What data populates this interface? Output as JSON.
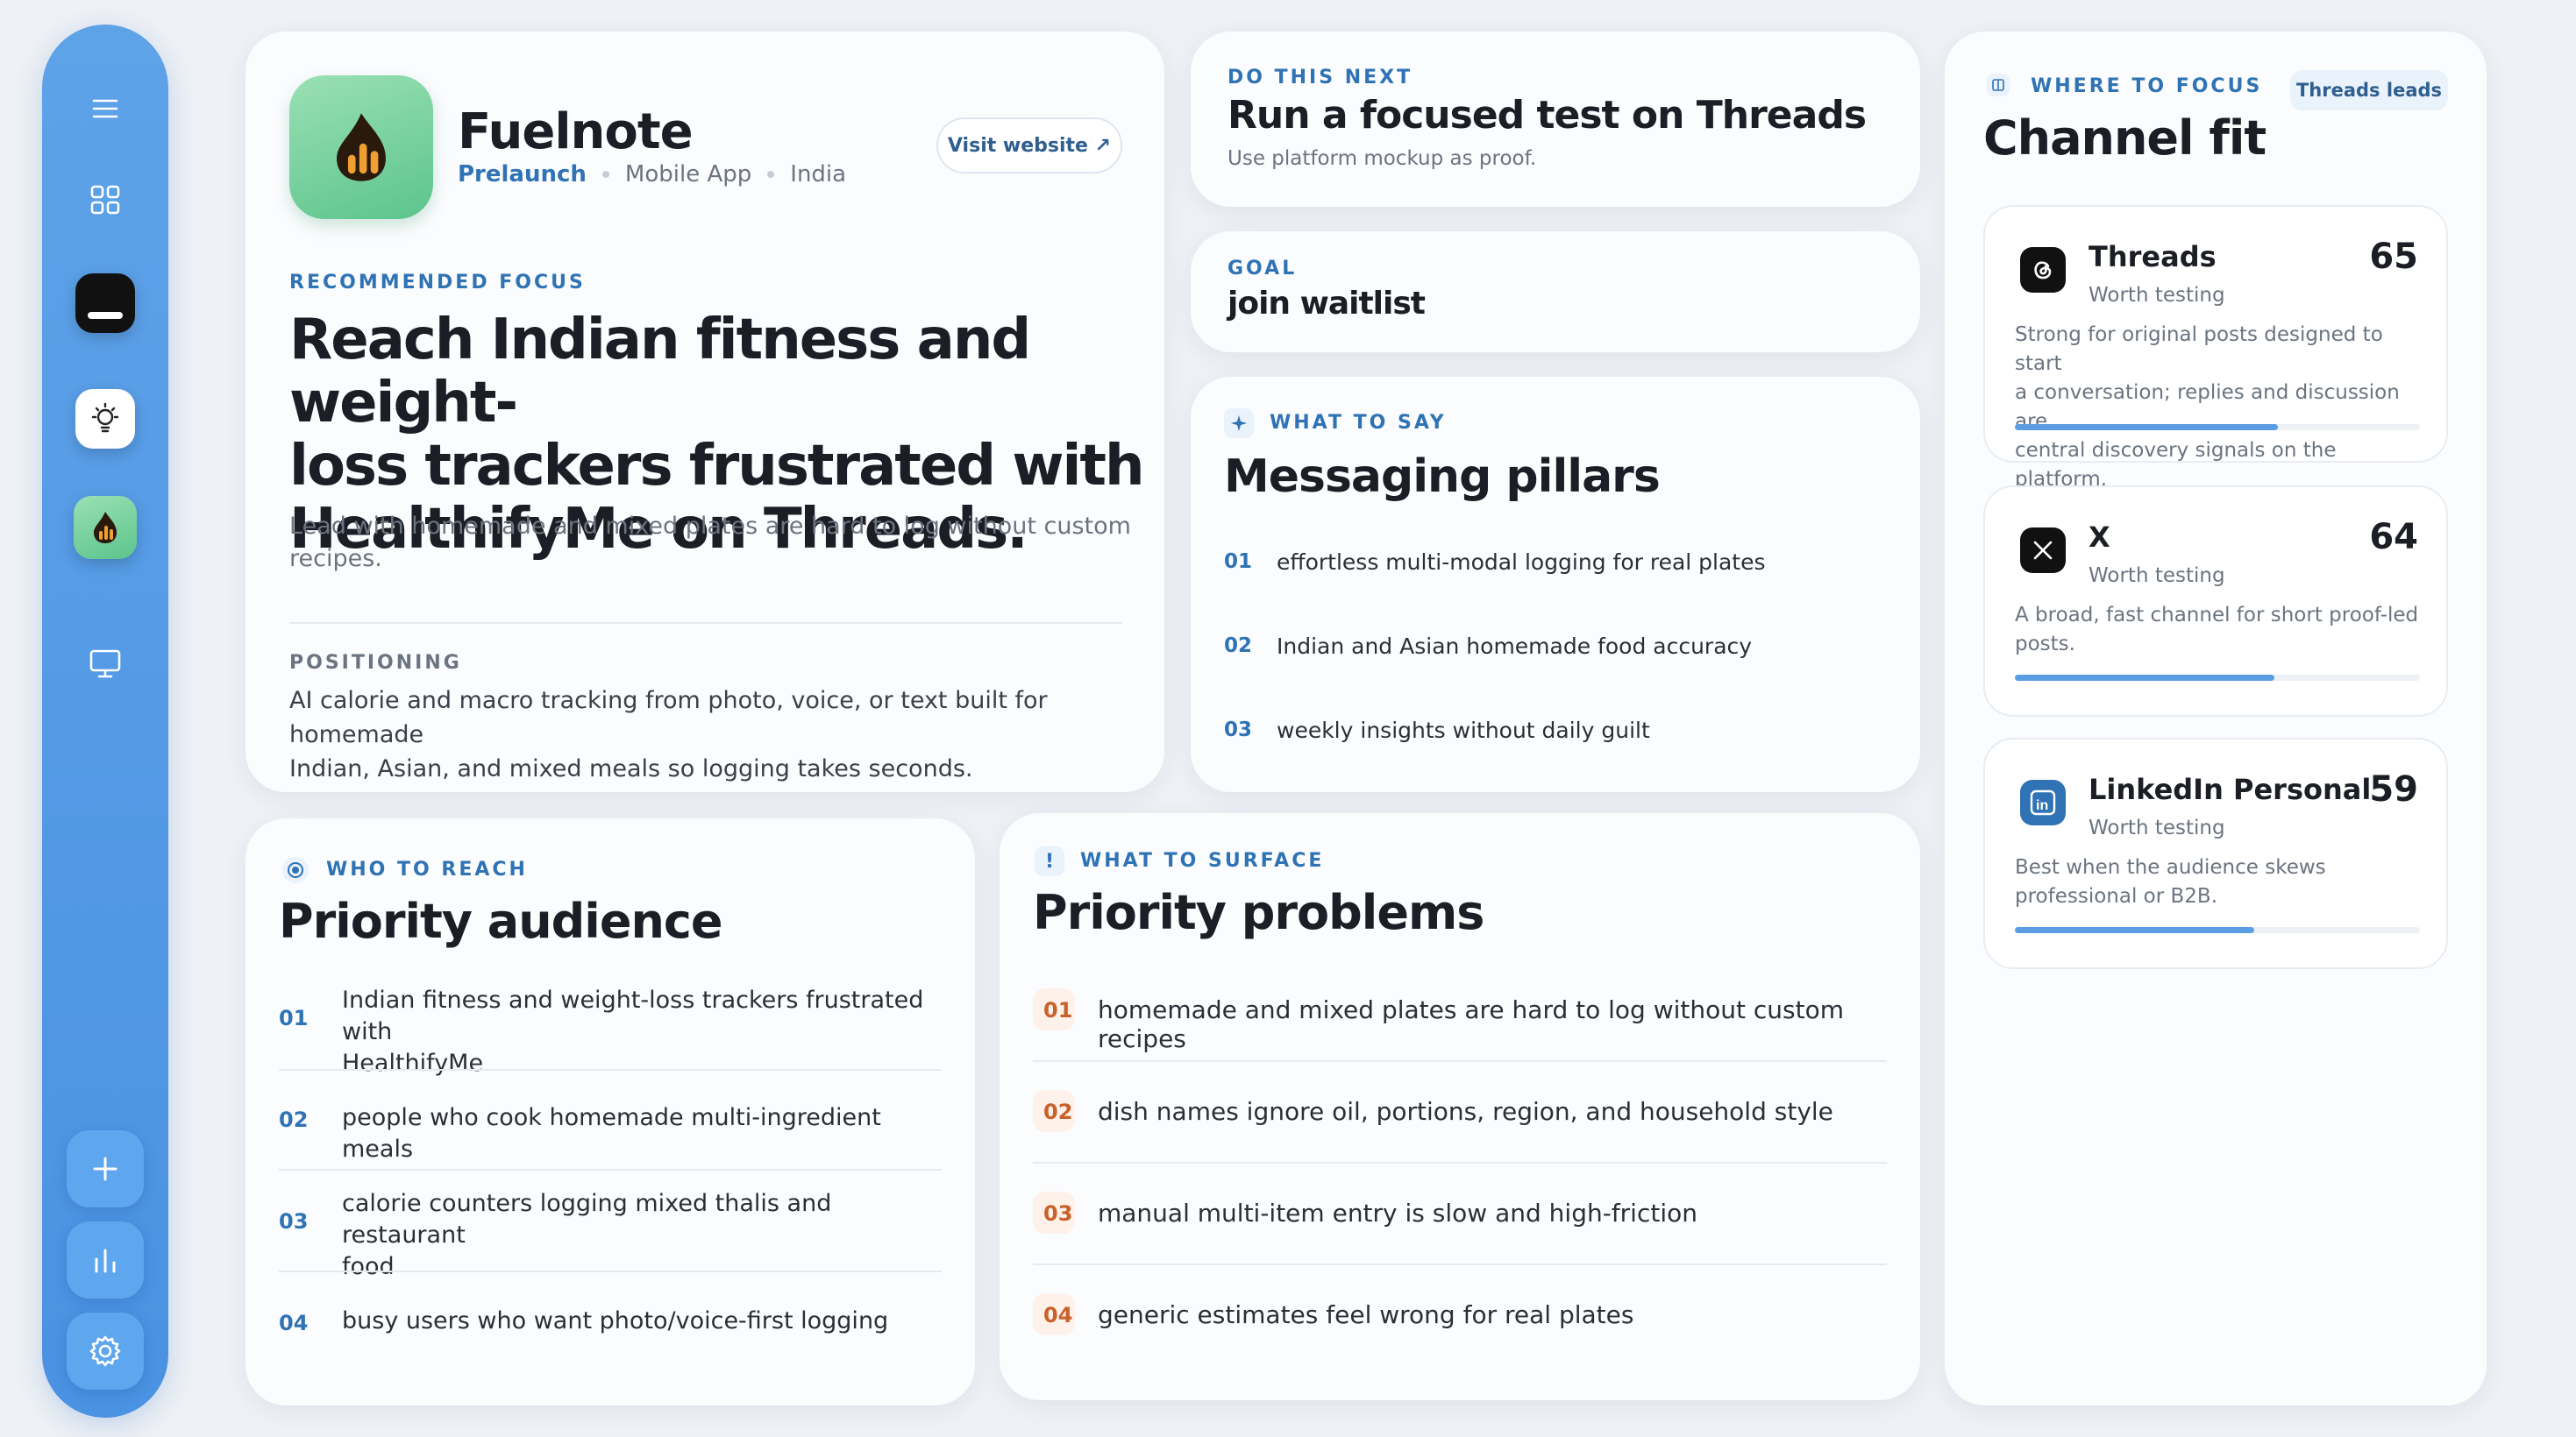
{
  "app": {
    "name": "Fuelnote",
    "meta": [
      "Prelaunch",
      "Mobile App",
      "India"
    ],
    "visit_label": "Visit website ↗"
  },
  "sidebar": {
    "icons": [
      "menu-icon",
      "grid-icon",
      "app-dark-icon",
      "lightbulb-icon",
      "fuelnote-icon",
      "monitor-icon",
      "plus-icon",
      "chart-icon",
      "gear-icon"
    ]
  },
  "focus": {
    "eyebrow": "RECOMMENDED FOCUS",
    "headline_lines": [
      "Reach Indian fitness and weight-",
      "loss trackers frustrated with",
      "HealthifyMe on Threads."
    ],
    "sub_lines": [
      "Lead with homemade and mixed plates are hard to log without custom",
      "recipes."
    ],
    "positioning_label": "POSITIONING",
    "positioning_lines": [
      "AI calorie and macro tracking from photo, voice, or text built for homemade",
      "Indian, Asian, and mixed meals so logging takes seconds."
    ]
  },
  "next": {
    "eyebrow": "DO THIS NEXT",
    "title": "Run a focused test on Threads",
    "sub": "Use platform mockup as proof."
  },
  "goal": {
    "eyebrow": "GOAL",
    "value": "join waitlist"
  },
  "pillars": {
    "eyebrow": "WHAT TO SAY",
    "title": "Messaging pillars",
    "items": [
      {
        "num": "01",
        "text": "effortless multi-modal logging for real plates"
      },
      {
        "num": "02",
        "text": "Indian and Asian homemade food accuracy"
      },
      {
        "num": "03",
        "text": "weekly insights without daily guilt"
      }
    ]
  },
  "audience": {
    "eyebrow": "WHO TO REACH",
    "title": "Priority audience",
    "items": [
      {
        "num": "01",
        "lines": [
          "Indian fitness and weight-loss trackers frustrated with",
          "HealthifyMe"
        ]
      },
      {
        "num": "02",
        "lines": [
          "people who cook homemade multi-ingredient meals"
        ]
      },
      {
        "num": "03",
        "lines": [
          "calorie counters logging mixed thalis and restaurant",
          "food"
        ]
      },
      {
        "num": "04",
        "lines": [
          "busy users who want photo/voice-first logging"
        ]
      }
    ]
  },
  "problems": {
    "eyebrow": "WHAT TO SURFACE",
    "title": "Priority problems",
    "items": [
      {
        "num": "01",
        "text": "homemade and mixed plates are hard to log without custom recipes"
      },
      {
        "num": "02",
        "text": "dish names ignore oil, portions, region, and household style"
      },
      {
        "num": "03",
        "text": "manual multi-item entry is slow and high-friction"
      },
      {
        "num": "04",
        "text": "generic estimates feel wrong for real plates"
      }
    ]
  },
  "channels": {
    "eyebrow": "WHERE TO FOCUS",
    "title": "Channel fit",
    "badge": "Threads leads",
    "items": [
      {
        "name": "Threads",
        "score": "65",
        "status": "Worth testing",
        "icon": "threads-icon",
        "fit": 0.65,
        "desc_lines": [
          "Strong for original posts designed to start",
          "a conversation; replies and discussion are",
          "central discovery signals on the platform."
        ]
      },
      {
        "name": "X",
        "score": "64",
        "status": "Worth testing",
        "icon": "x-icon",
        "fit": 0.64,
        "desc_lines": [
          "A broad, fast channel for short proof-led",
          "posts."
        ]
      },
      {
        "name": "LinkedIn Personal",
        "score": "59",
        "status": "Worth testing",
        "icon": "linkedin-icon",
        "fit": 0.59,
        "desc_lines": [
          "Best when the audience skews",
          "professional or B2B."
        ]
      }
    ]
  },
  "colors": {
    "accent": "#4a92e2",
    "problem_accent": "#c9622a",
    "logo_green": "#5cc48c"
  }
}
